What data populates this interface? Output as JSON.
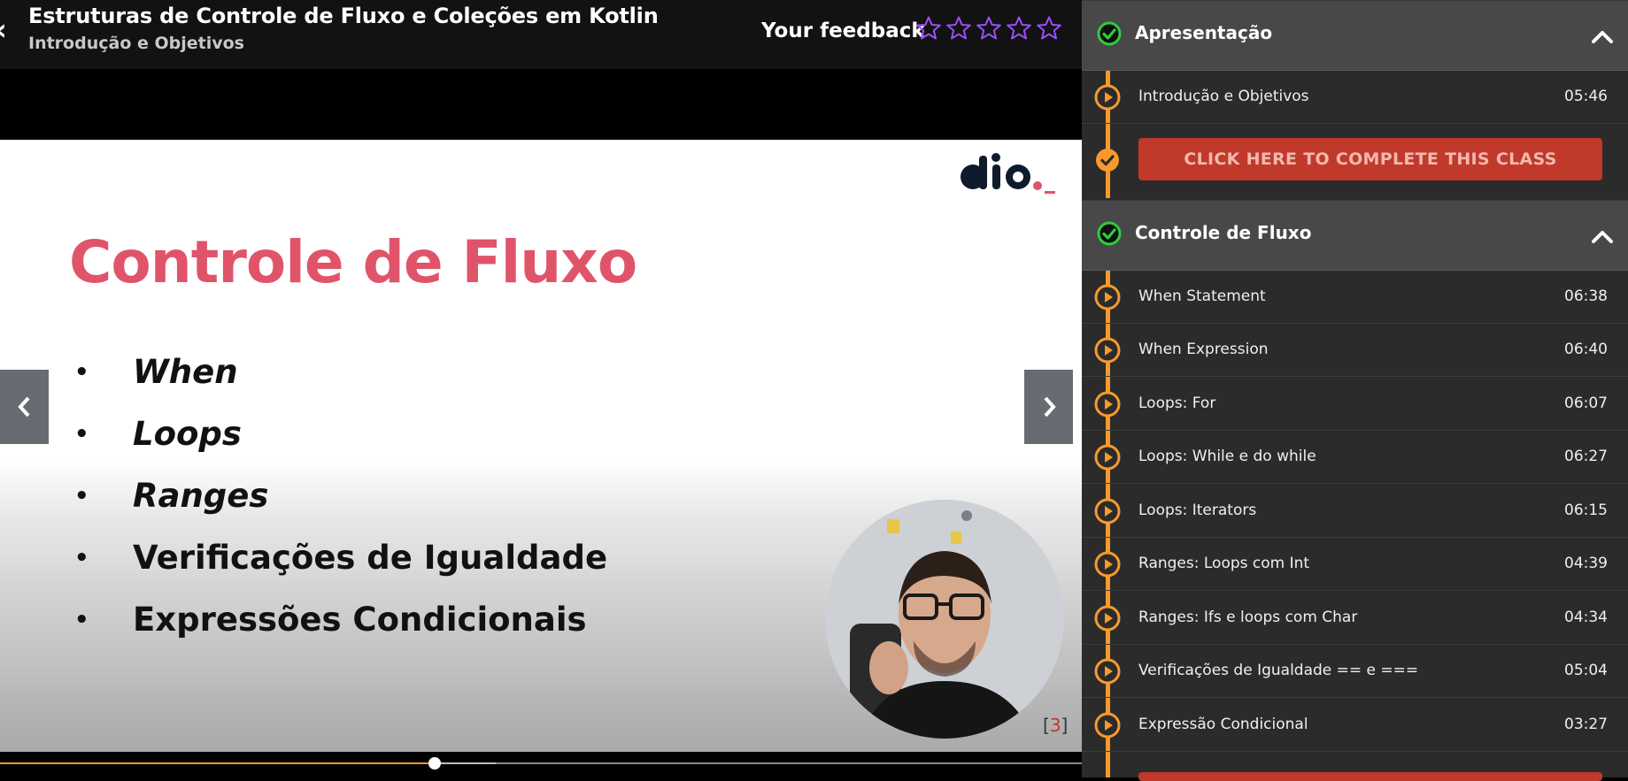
{
  "header": {
    "course_title": "Estruturas de Controle de Fluxo e Coleções em Kotlin",
    "current_lesson": "Introdução e Objetivos",
    "feedback_label": "Your feedback",
    "rating": {
      "value": 0,
      "max": 5
    },
    "star_color": "#9b4dff"
  },
  "slide": {
    "title": "Controle de Fluxo",
    "items": [
      {
        "text": "When",
        "italic": true
      },
      {
        "text": "Loops",
        "italic": true
      },
      {
        "text": "Ranges",
        "italic": true
      },
      {
        "text": "Verificações de Igualdade",
        "italic": false
      },
      {
        "text": "Expressões Condicionais",
        "italic": false
      }
    ],
    "page_number": "3",
    "bullet": "•"
  },
  "player": {
    "prev_icon": "chevron-left-icon",
    "next_icon": "chevron-right-icon",
    "progress": 0.402,
    "buffered": 0.458
  },
  "sidebar": {
    "sections": [
      {
        "title": "Apresentação",
        "completed": true,
        "lessons": [
          {
            "label": "Introdução e Objetivos",
            "duration": "05:46"
          }
        ],
        "complete_button": "CLICK HERE TO COMPLETE THIS CLASS"
      },
      {
        "title": "Controle de Fluxo",
        "completed": true,
        "lessons": [
          {
            "label": "When Statement",
            "duration": "06:38"
          },
          {
            "label": "When Expression",
            "duration": "06:40"
          },
          {
            "label": "Loops: For",
            "duration": "06:07"
          },
          {
            "label": "Loops: While e do while",
            "duration": "06:27"
          },
          {
            "label": "Loops: Iterators",
            "duration": "06:15"
          },
          {
            "label": "Ranges: Loops com Int",
            "duration": "04:39"
          },
          {
            "label": "Ranges: Ifs e loops com Char",
            "duration": "04:34"
          },
          {
            "label": "Verificações de Igualdade == e ===",
            "duration": "05:04"
          },
          {
            "label": "Expressão Condicional",
            "duration": "03:27"
          }
        ]
      }
    ]
  },
  "colors": {
    "accent": "#f89a2b",
    "complete_button": "#c0392b",
    "check_green": "#2ecc40",
    "slide_title": "#e0546a"
  }
}
